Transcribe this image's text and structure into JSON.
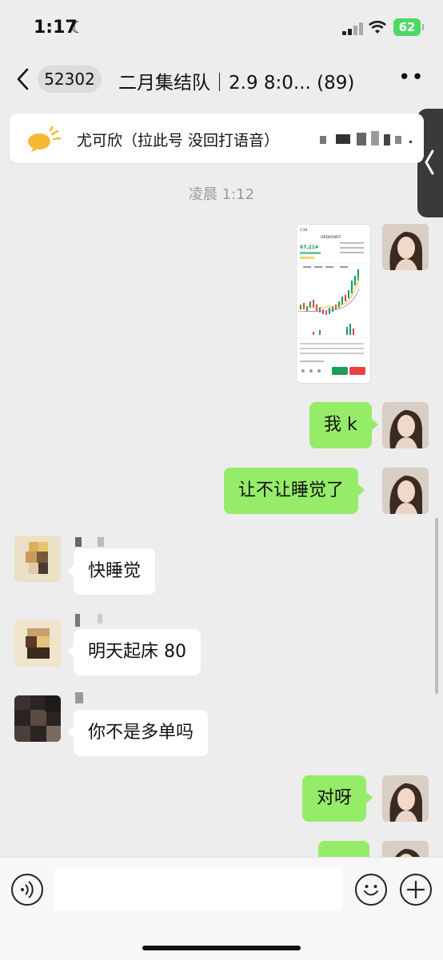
{
  "status": {
    "time": "1:17",
    "battery": "62"
  },
  "header": {
    "badge": "52302",
    "title": "二月集结队｜2.9 8:0... (89)"
  },
  "notice": {
    "text": "尤可欣（拉此号 没回打语音）"
  },
  "timestamp": "凌晨 1:12",
  "messages": {
    "m1": "我 k",
    "m2": "让不让睡觉了",
    "m3": "快睡觉",
    "m4": "明天起床 80",
    "m5": "你不是多单吗",
    "m6": "对呀"
  },
  "screenshot_thumb": {
    "pair": "ORDI/USDT",
    "price": "67,214"
  },
  "colors": {
    "bubble_self": "#95ec69",
    "bubble_other": "#ffffff",
    "background": "#ededed"
  }
}
